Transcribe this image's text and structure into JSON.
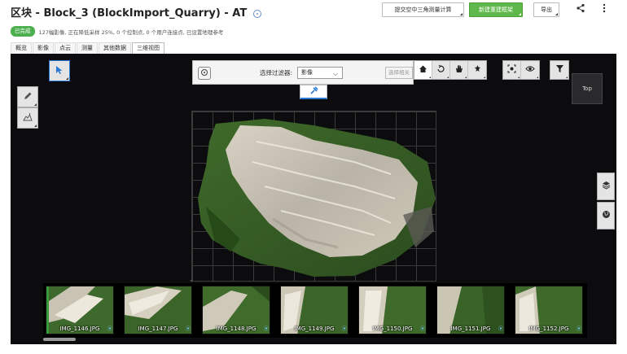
{
  "header": {
    "title_prefix": "区块 - ",
    "title_name": "Block_3 (BlockImport_Quarry) - AT",
    "status_badge": "已完成",
    "status_text": "127幅影像, 正在降低采样 25%, 0 个控制点, 0 个用户连接点, 已设置地理参考",
    "btn_submit_at": "提交空中三角测量计算",
    "btn_new_reconstruction": "新建重建框架",
    "btn_export": "导出",
    "share_icon": "share-icon",
    "more_icon": "more-vertical-icon"
  },
  "tabs": [
    {
      "label": "概览",
      "active": false
    },
    {
      "label": "影像",
      "active": false
    },
    {
      "label": "点云",
      "active": false
    },
    {
      "label": "测量",
      "active": false
    },
    {
      "label": "其他数据",
      "active": false
    },
    {
      "label": "三维视图",
      "active": true
    }
  ],
  "viewer": {
    "filter_label": "选择过滤器:",
    "filter_value": "影像",
    "select_related": "选择相关",
    "navcube_label": "Top",
    "toolbar_icons": [
      "home-icon",
      "rotate-icon",
      "pan-hand-icon",
      "zoom-icon",
      "zoom-fit-icon",
      "eye-icon",
      "filter-icon"
    ],
    "left_tools": [
      "select-arrow-icon",
      "measure-pen-icon",
      "terrain-icon"
    ],
    "right_tools": [
      "layers-icon",
      "globe-icon"
    ]
  },
  "filmstrip": [
    {
      "name": "IMG_1146.JPG",
      "selected": true
    },
    {
      "name": "IMG_1147.JPG",
      "selected": false
    },
    {
      "name": "IMG_1148.JPG",
      "selected": false
    },
    {
      "name": "IMG_1149.JPG",
      "selected": false
    },
    {
      "name": "IMG_1150.JPG",
      "selected": false
    },
    {
      "name": "IMG_1151.JPG",
      "selected": false
    },
    {
      "name": "IMG_1152.JPG",
      "selected": false
    }
  ],
  "colors": {
    "accent_green": "#5fb84a",
    "badge_green": "#4caf50",
    "viewer_bg": "#0c0c0e",
    "selection_blue": "#2a7ad5"
  }
}
